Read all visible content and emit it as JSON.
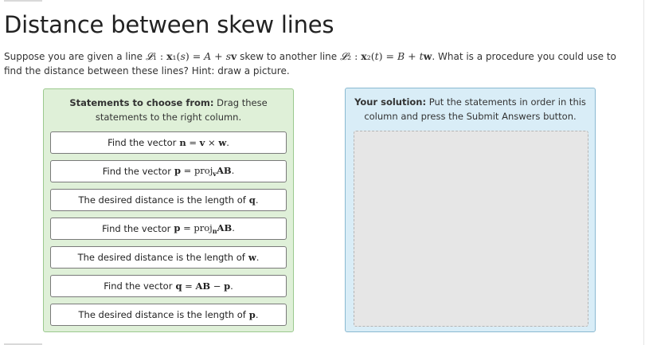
{
  "title": "Distance between skew lines",
  "prompt": {
    "before": "Suppose you are given a line ",
    "line1_math": "𝓛₁ : x₁(s) = A + sv",
    "middle": " skew to another line ",
    "line2_math": "𝓛₂ : x₂(t) = B + tw",
    "after": ". What is a procedure you could use to find the distance between these lines? Hint: draw a picture."
  },
  "source_column": {
    "heading_bold": "Statements to choose from:",
    "heading_text": " Drag these statements to the right column.",
    "items": [
      {
        "text": "Find the vector",
        "math": "n = v × w."
      },
      {
        "text": "Find the vector",
        "math": "p = proj_v AB."
      },
      {
        "text": "The desired distance is the length of",
        "math": "q."
      },
      {
        "text": "Find the vector",
        "math": "p = proj_n AB."
      },
      {
        "text": "The desired distance is the length of",
        "math": "w."
      },
      {
        "text": "Find the vector",
        "math": "q = AB − p."
      },
      {
        "text": "The desired distance is the length of",
        "math": "p."
      }
    ]
  },
  "solution_column": {
    "heading_bold": "Your solution:",
    "heading_text": " Put the statements in order in this column and press the Submit Answers button."
  }
}
